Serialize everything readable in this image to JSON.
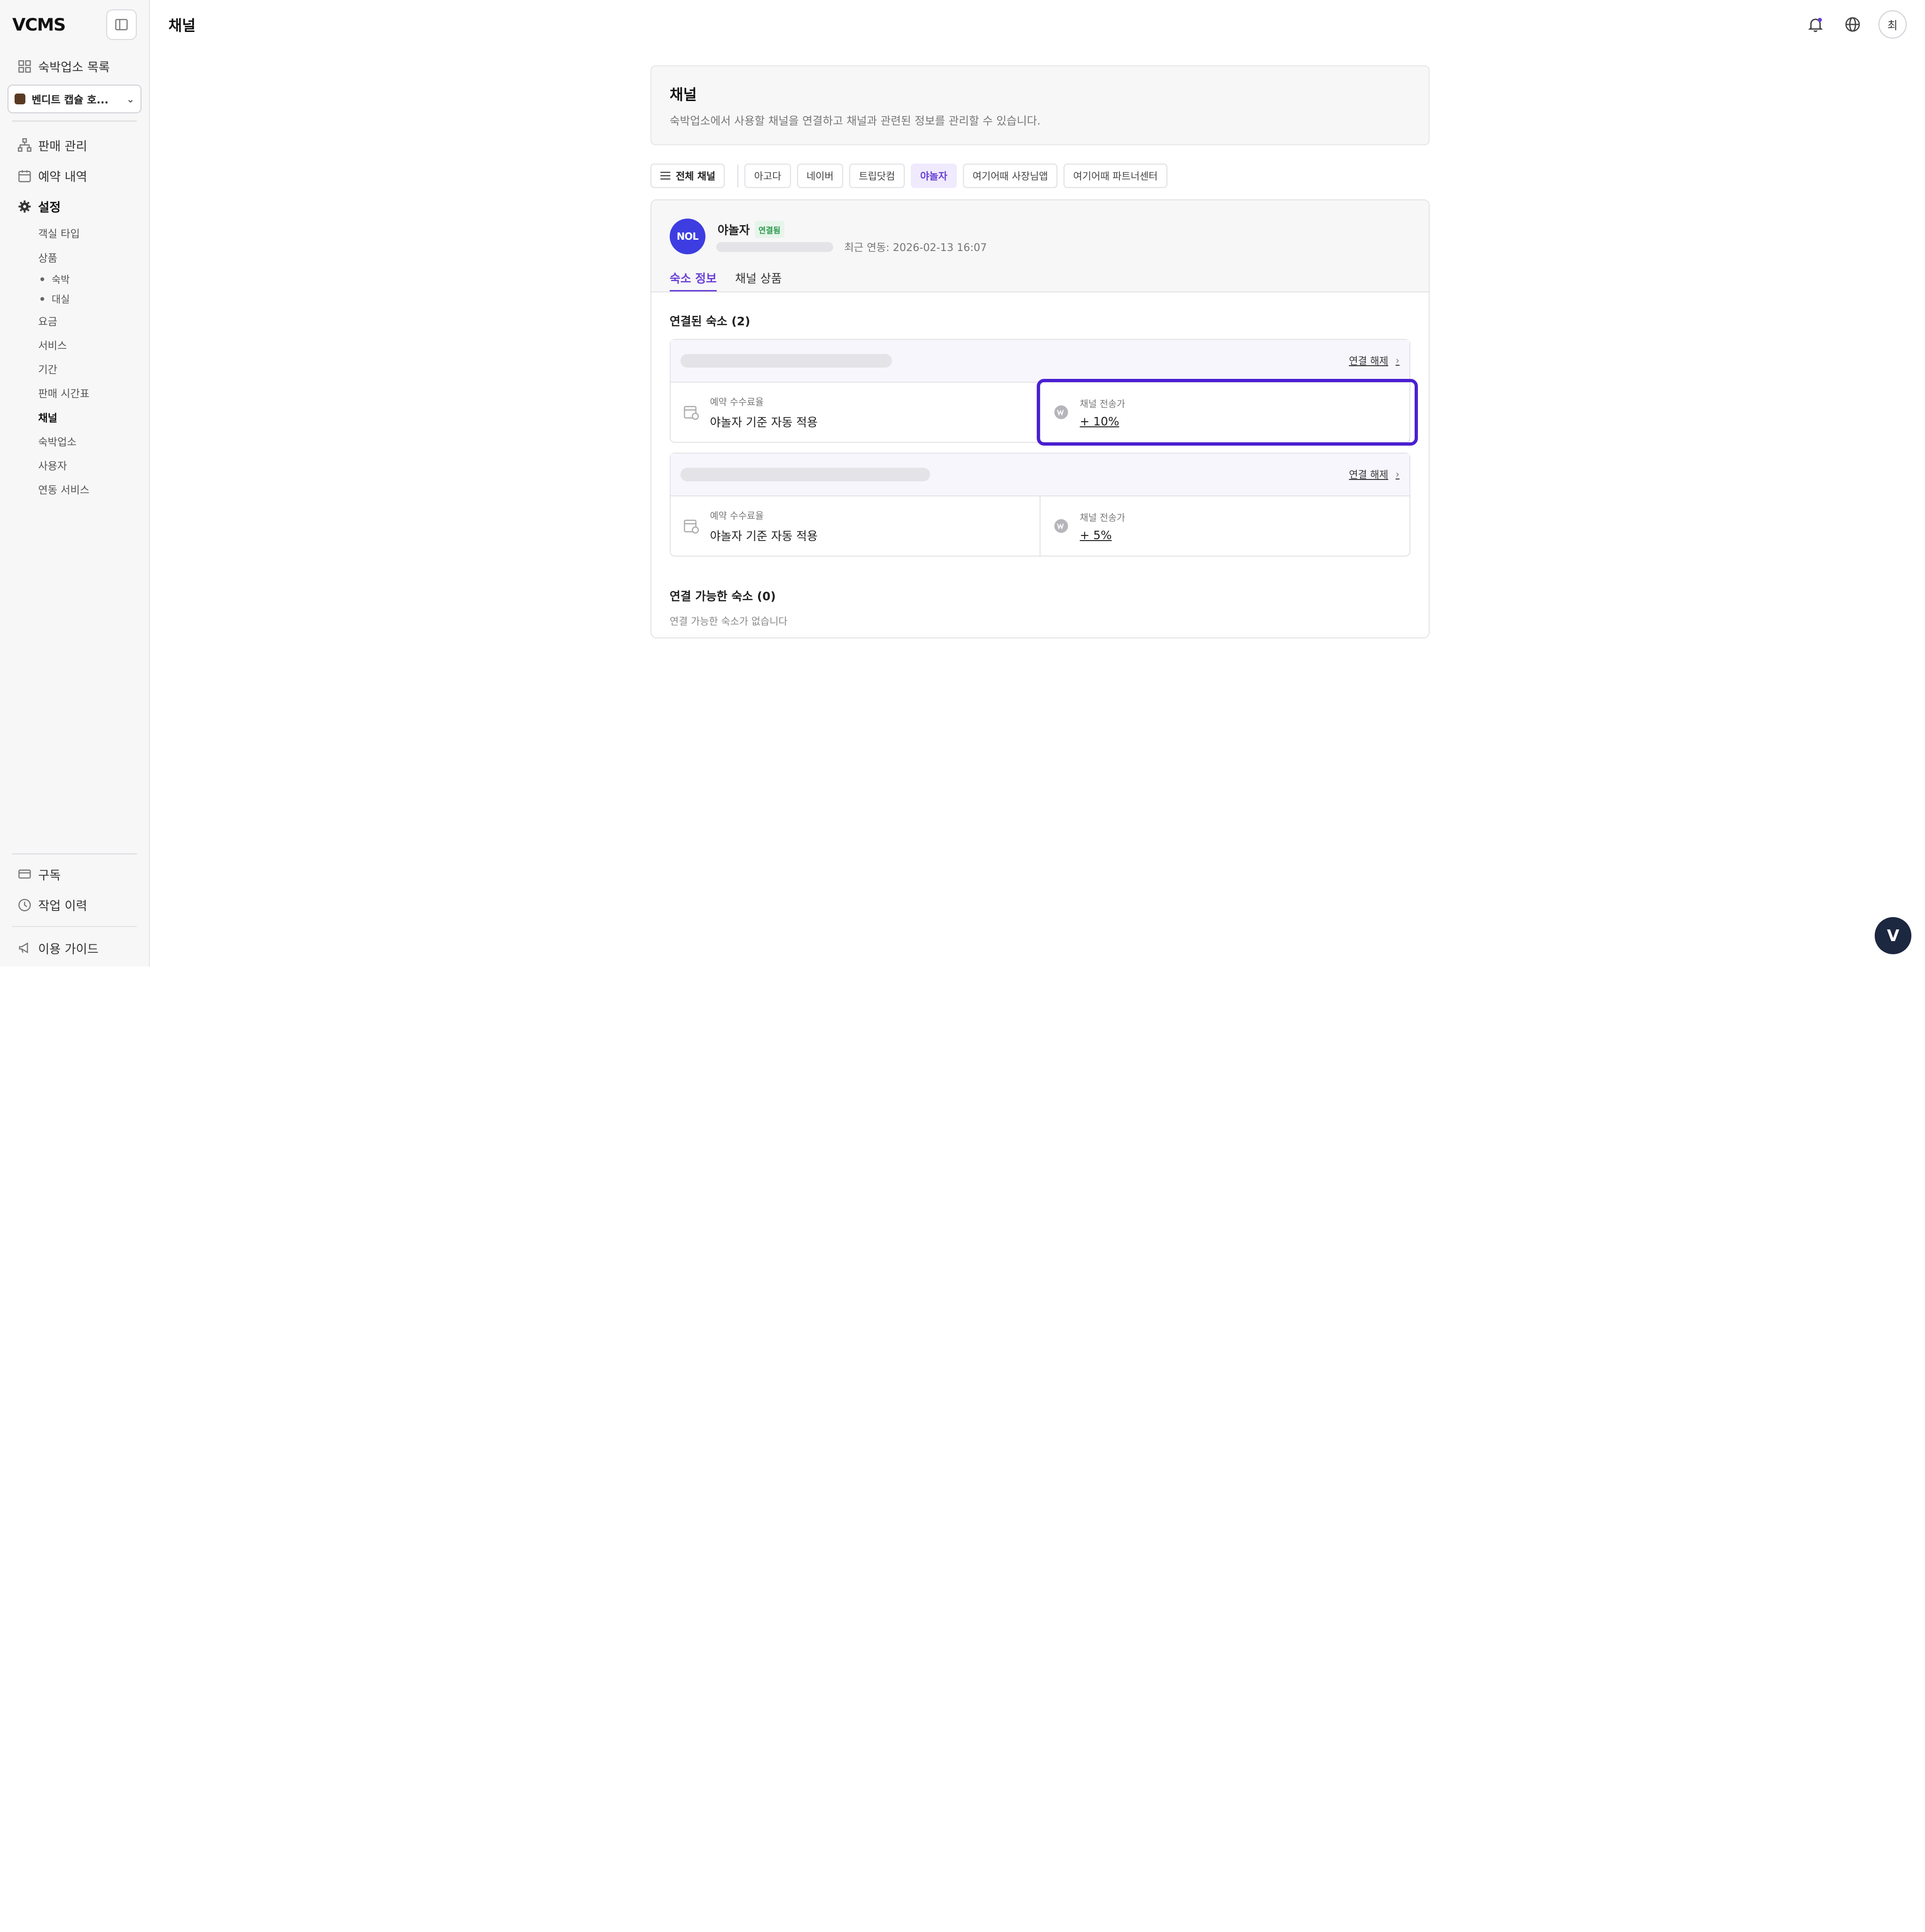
{
  "app": {
    "logo": "VCMS"
  },
  "sidebar": {
    "top_items": [
      {
        "label": "숙박업소 목록",
        "icon": "grid-icon"
      }
    ],
    "property_select": {
      "value": "벤디트 캡슐 호..."
    },
    "main_items": [
      {
        "label": "판매 관리",
        "icon": "sitemap-icon"
      },
      {
        "label": "예약 내역",
        "icon": "calendar-icon"
      },
      {
        "label": "설정",
        "icon": "gear-icon"
      }
    ],
    "settings_sub": [
      "객실 타입",
      "상품"
    ],
    "product_sub": [
      "숙박",
      "대실"
    ],
    "settings_sub2": [
      "요금",
      "서비스",
      "기간",
      "판매 시간표",
      "채널",
      "숙박업소",
      "사용자",
      "연동 서비스"
    ],
    "active_sub": "채널",
    "bottom_items": [
      {
        "label": "구독",
        "icon": "card-icon"
      },
      {
        "label": "작업 이력",
        "icon": "clock-icon"
      }
    ],
    "guide": {
      "label": "이용 가이드",
      "icon": "megaphone-icon"
    }
  },
  "topbar": {
    "title": "채널",
    "avatar": "최"
  },
  "header": {
    "title": "채널",
    "description": "숙박업소에서 사용할 채널을 연결하고 채널과 관련된 정보를 관리할 수 있습니다."
  },
  "filters": {
    "all_label": "전체 채널",
    "channels": [
      "아고다",
      "네이버",
      "트립닷컴",
      "야놀자",
      "여기어때 사장님앱",
      "여기어때 파트너센터"
    ],
    "active": "야놀자"
  },
  "channel": {
    "logo_text": "NOL",
    "name": "야놀자",
    "status": "연결됨",
    "last_sync": "최근 연동: 2026-02-13 16:07",
    "tabs": [
      "숙소 정보",
      "채널 상품"
    ],
    "active_tab": "숙소 정보",
    "connected_title": "연결된 숙소 (2)",
    "properties": [
      {
        "unlink_label": "연결 해제",
        "commission_label": "예약 수수료율",
        "commission_value": "야놀자 기준 자동 적용",
        "price_label": "채널 전송가",
        "price_value": "+ 10%",
        "highlighted": true
      },
      {
        "unlink_label": "연결 해제",
        "commission_label": "예약 수수료율",
        "commission_value": "야놀자 기준 자동 적용",
        "price_label": "채널 전송가",
        "price_value": "+ 5%",
        "highlighted": false
      }
    ],
    "available_title": "연결 가능한 숙소 (0)",
    "available_empty": "연결 가능한 숙소가 없습니다"
  },
  "colors": {
    "accent": "#6a3fd6",
    "highlight": "#4a1fd1",
    "nol_blue": "#3d3de2"
  },
  "fab": {
    "label": "V"
  }
}
